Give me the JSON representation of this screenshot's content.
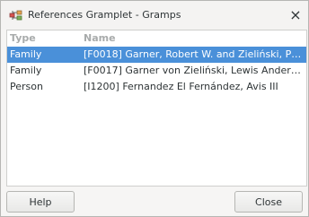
{
  "window": {
    "title": "References Gramplet - Gramps",
    "app_icon": "gramps-tree-icon",
    "close_glyph": "×"
  },
  "list": {
    "columns": [
      "Type",
      "Name"
    ],
    "rows": [
      {
        "type": "Family",
        "name": "[F0018] Garner, Robert W. and Zieliński, Ph...",
        "selected": true
      },
      {
        "type": "Family",
        "name": "[F0017] Garner von Zieliński, Lewis Anderso...",
        "selected": false
      },
      {
        "type": "Person",
        "name": "[I1200] Fernandez El Fernández, Avis III",
        "selected": false
      }
    ]
  },
  "buttons": {
    "help": "Help",
    "close": "Close"
  },
  "colors": {
    "selection": "#4a90d9",
    "header_text": "#a8abab"
  }
}
